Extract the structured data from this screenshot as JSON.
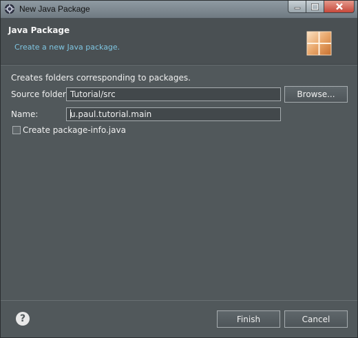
{
  "window": {
    "title": "New Java Package",
    "controls": {
      "minimize": "—",
      "maximize": "□",
      "close": "✕"
    }
  },
  "header": {
    "title": "Java Package",
    "description": "Create a new Java package.",
    "image_icon": "package-wizard-banner-icon"
  },
  "form": {
    "intro": "Creates folders corresponding to packages.",
    "source_folder_label": "Source folder:",
    "source_folder_value": "Tutorial/src",
    "browse_label": "Browse...",
    "name_label": "Name:",
    "name_value": "u.paul.tutorial.main",
    "create_info_label": "Create package-info.java",
    "create_info_checked": false
  },
  "footer": {
    "help_label": "?",
    "finish_label": "Finish",
    "cancel_label": "Cancel"
  },
  "colors": {
    "background": "#51585b",
    "header_background": "#4a5053",
    "description_text": "#7fc6e2",
    "field_background": "#42484b",
    "border": "#a7adb0"
  }
}
